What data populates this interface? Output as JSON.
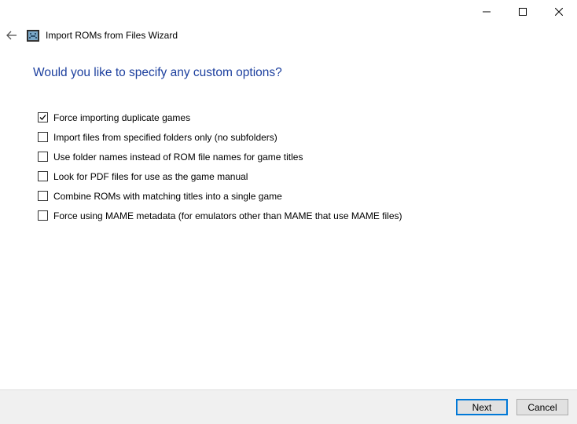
{
  "window": {
    "title": "Import ROMs from Files Wizard",
    "controls": [
      "minimize-icon",
      "maximize-icon",
      "close-icon"
    ]
  },
  "page": {
    "heading": "Would you like to specify any custom options?"
  },
  "options": [
    {
      "label": "Force importing duplicate games",
      "checked": true
    },
    {
      "label": "Import files from specified folders only (no subfolders)",
      "checked": false
    },
    {
      "label": "Use folder names instead of ROM file names for game titles",
      "checked": false
    },
    {
      "label": "Look for PDF files for use as the game manual",
      "checked": false
    },
    {
      "label": "Combine ROMs with matching titles into a single game",
      "checked": false
    },
    {
      "label": "Force using MAME metadata (for emulators other than MAME that use MAME files)",
      "checked": false
    }
  ],
  "footer": {
    "next_label": "Next",
    "cancel_label": "Cancel"
  },
  "colors": {
    "heading": "#1c3f9e",
    "default_button_border": "#0078d7",
    "footer_bg": "#f0f0f0"
  }
}
